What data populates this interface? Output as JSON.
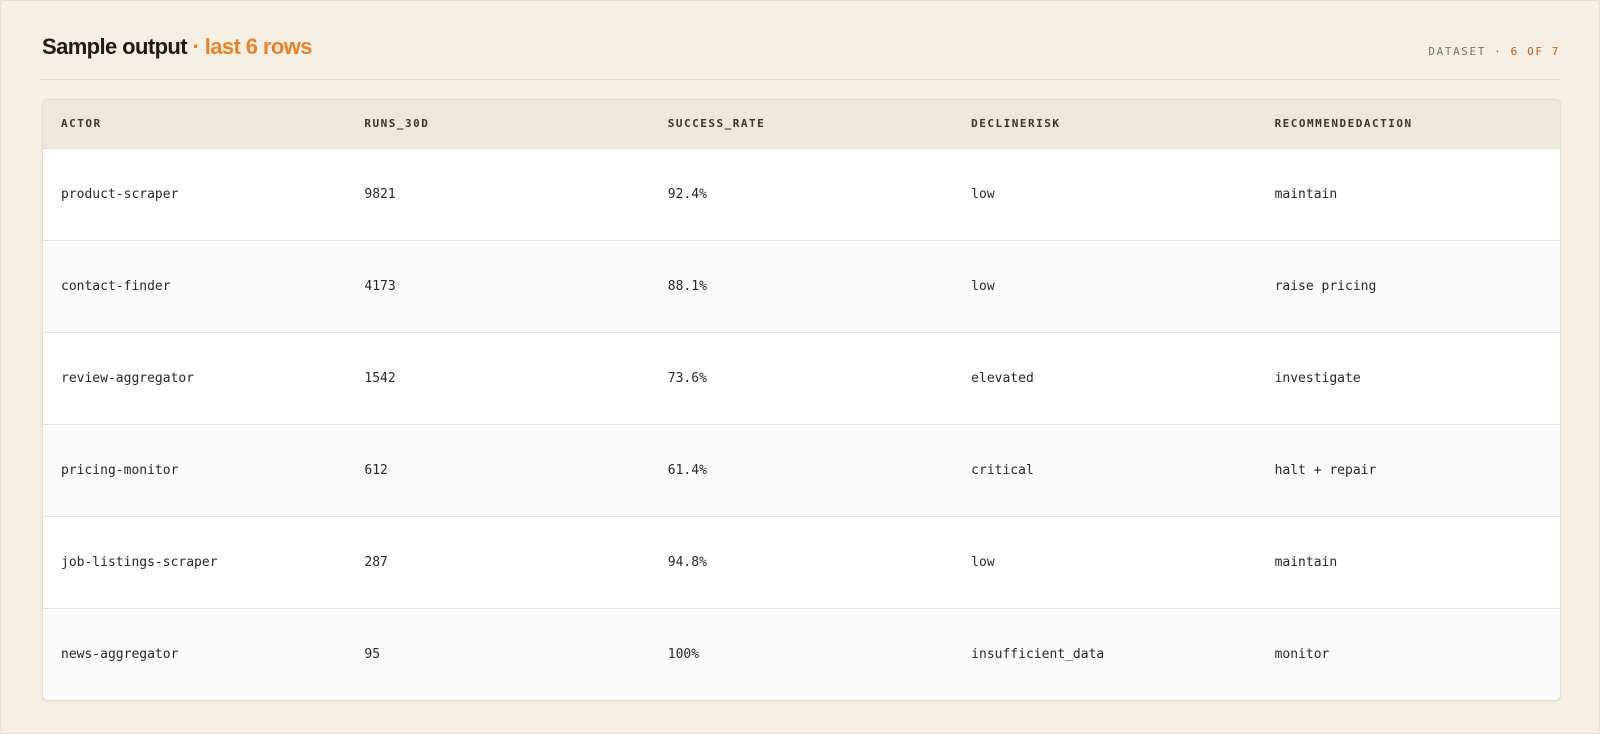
{
  "header": {
    "title": "Sample output",
    "title_accent": "· last 6 rows",
    "meta_label": "DATASET ·",
    "meta_count": "6 OF 7"
  },
  "table": {
    "columns": [
      "ACTOR",
      "RUNS_30D",
      "SUCCESS_RATE",
      "DECLINERISK",
      "RECOMMENDEDACTION"
    ],
    "rows": [
      [
        "product-scraper",
        "9821",
        "92.4%",
        "low",
        "maintain"
      ],
      [
        "contact-finder",
        "4173",
        "88.1%",
        "low",
        "raise pricing"
      ],
      [
        "review-aggregator",
        "1542",
        "73.6%",
        "elevated",
        "investigate"
      ],
      [
        "pricing-monitor",
        "612",
        "61.4%",
        "critical",
        "halt + repair"
      ],
      [
        "job-listings-scraper",
        "287",
        "94.8%",
        "low",
        "maintain"
      ],
      [
        "news-aggregator",
        "95",
        "100%",
        "insufficient_data",
        "monitor"
      ]
    ]
  },
  "colors": {
    "background": "#f5efe4",
    "accent": "#e8822a",
    "header_row": "#efe7da"
  }
}
